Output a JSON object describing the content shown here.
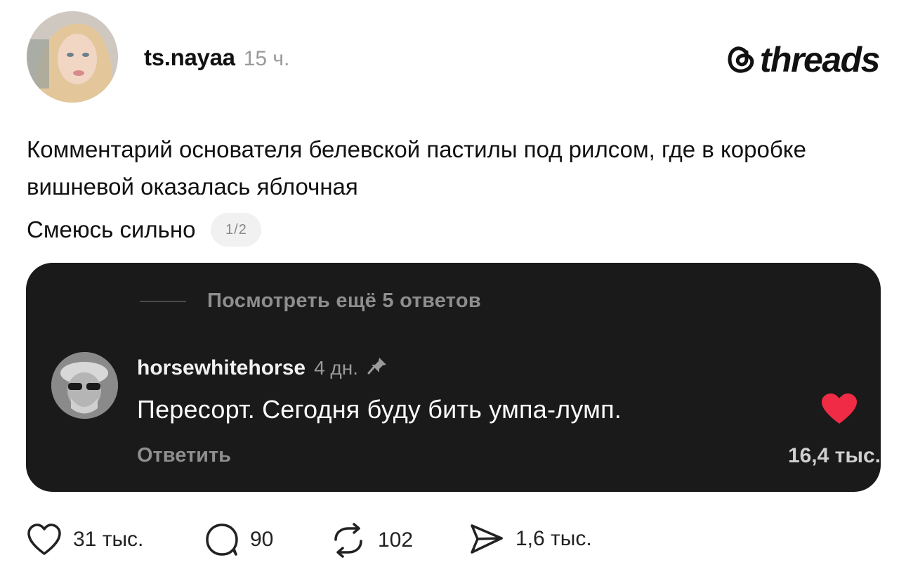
{
  "post": {
    "username": "ts.nayaa",
    "time": "15 ч.",
    "brand": "threads",
    "text": "Комментарий основателя белевской пастилы под рилсом, где в коробке вишневой оказалась яблочная",
    "subtext": "Смеюсь сильно",
    "pager": "1/2"
  },
  "screenshot": {
    "view_more": "Посмотреть ещё 5 ответов",
    "comment": {
      "username": "horsewhitehorse",
      "time": "4 дн.",
      "text": "Пересорт. Сегодня буду бить умпа-лумп.",
      "reply_label": "Ответить",
      "likes": "16,4 тыс."
    }
  },
  "actions": {
    "likes": "31 тыс.",
    "comments": "90",
    "reposts": "102",
    "shares": "1,6 тыс."
  },
  "icons": {
    "like": "heart-outline-icon",
    "comment": "speech-bubble-icon",
    "repost": "repost-arrows-icon",
    "share": "paper-plane-icon",
    "brand": "threads-logo-icon",
    "pin": "pin-icon",
    "liked": "heart-filled-icon"
  },
  "colors": {
    "heart": "#ef2b45",
    "card_bg": "#1a1a1a",
    "muted": "#9a9a9a"
  }
}
